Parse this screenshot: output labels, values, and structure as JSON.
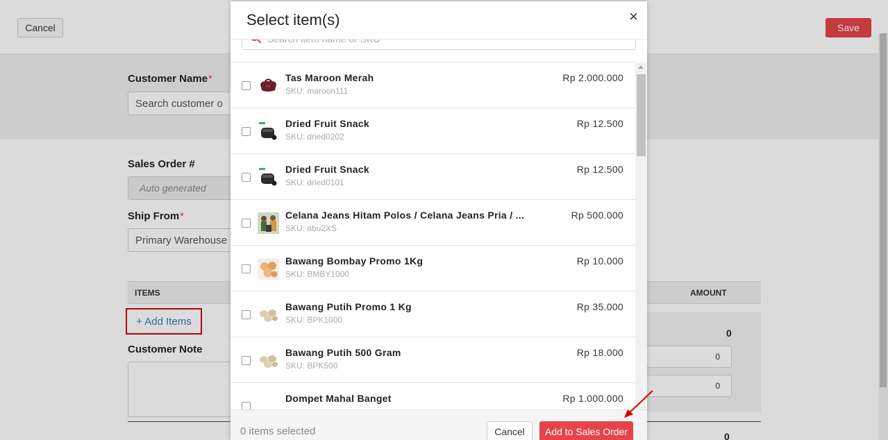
{
  "page": {
    "cancel_label": "Cancel",
    "save_label": "Save",
    "customer_name_label": "Customer Name",
    "required_mark": "*",
    "customer_search_placeholder": "Search customer o",
    "sales_order_label": "Sales Order #",
    "sales_order_placeholder": "Auto generated",
    "ship_from_label": "Ship From",
    "ship_from_value": "Primary Warehouse",
    "items_header": "ITEMS",
    "amount_header": "AMOUNT",
    "add_items_label": "+ Add Items",
    "customer_note_label": "Customer Note",
    "subtotal_value": "0",
    "input_value_1": "0",
    "input_value_2": "0",
    "grand_total_value": "0"
  },
  "modal": {
    "title": "Select item(s)",
    "close_symbol": "×",
    "search_placeholder": "Search item name or SKU",
    "items": [
      {
        "name": "Tas Maroon Merah",
        "sku": "SKU: maroon111",
        "price": "Rp 2.000.000",
        "icon": "maroon-bag-thumbnail"
      },
      {
        "name": "Dried Fruit Snack",
        "sku": "SKU: dried0202",
        "price": "Rp 12.500",
        "icon": "earbuds-case-thumbnail"
      },
      {
        "name": "Dried Fruit Snack",
        "sku": "SKU: dried0101",
        "price": "Rp 12.500",
        "icon": "earbuds-case-thumbnail"
      },
      {
        "name": "Celana Jeans Hitam Polos / Celana Jeans Pria / ...",
        "sku": "SKU: abu2XS",
        "price": "Rp 500.000",
        "icon": "people-photo-thumbnail"
      },
      {
        "name": "Bawang Bombay Promo 1Kg",
        "sku": "SKU: BMBY1000",
        "price": "Rp 10.000",
        "icon": "onion-thumbnail"
      },
      {
        "name": "Bawang Putih Promo 1 Kg",
        "sku": "SKU: BPK1000",
        "price": "Rp 35.000",
        "icon": "garlic-thumbnail"
      },
      {
        "name": "Bawang Putih 500 Gram",
        "sku": "SKU: BPK500",
        "price": "Rp 18.000",
        "icon": "garlic-thumbnail"
      },
      {
        "name": "Dompet Mahal Banget",
        "sku": "",
        "price": "Rp 1.000.000",
        "icon": "wallet-thumbnail"
      }
    ],
    "selected_count_text": "0 items selected",
    "cancel_label": "Cancel",
    "add_label": "Add to Sales Order"
  },
  "colors": {
    "accent": "#e4444a",
    "link": "#3a78c3",
    "highlight_border": "#d40000"
  }
}
